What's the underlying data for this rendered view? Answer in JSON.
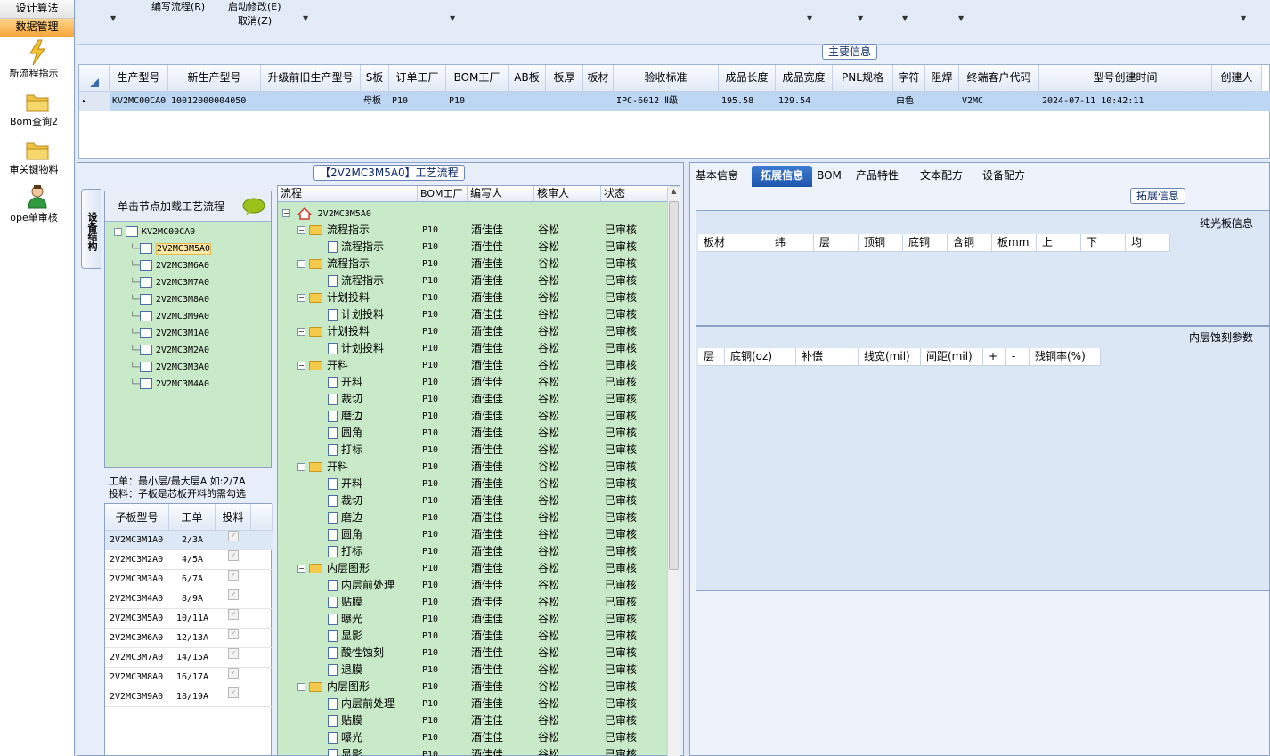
{
  "left_nav": {
    "tabs": [
      {
        "label": "设计算法"
      },
      {
        "label": "数据管理"
      }
    ],
    "items": [
      {
        "label": "新流程指示",
        "icon": "lightning-icon"
      },
      {
        "label": "Bom查询2",
        "icon": "folder-icon"
      },
      {
        "label": "审关键物料",
        "icon": "folder-icon"
      },
      {
        "label": "ope单审核",
        "icon": "user-icon"
      }
    ]
  },
  "toolbar": {
    "edit_flow": "编写流程(R)",
    "start_modify": "启动修改(E)",
    "cancel": "取消(Z)"
  },
  "main_info": {
    "legend": "主要信息",
    "columns": [
      "生产型号",
      "新生产型号",
      "升级前旧生产型号",
      "S板",
      "订单工厂",
      "BOM工厂",
      "AB板",
      "板厚",
      "板材",
      "验收标准",
      "成品长度",
      "成品宽度",
      "PNL规格",
      "字符",
      "阻焊",
      "终端客户代码",
      "型号创建时间",
      "创建人"
    ],
    "row": [
      "KV2MC00CA0",
      "10012000004050",
      "",
      "母板",
      "P10",
      "P10",
      "",
      "",
      "",
      "IPC-6012 Ⅱ级",
      "195.58",
      "129.54",
      "",
      "白色",
      "",
      "V2MC",
      "2024-07-11 10:42:11",
      ""
    ]
  },
  "flow_panel": {
    "legend": "【2V2MC3M5A0】工艺流程",
    "vertical_tab": "设备结构",
    "tree_header": "单击节点加载工艺流程",
    "tree_root": "KV2MC00CA0",
    "tree_nodes": [
      "2V2MC3M5A0",
      "2V2MC3M6A0",
      "2V2MC3M7A0",
      "2V2MC3M8A0",
      "2V2MC3M9A0",
      "2V2MC3M1A0",
      "2V2MC3M2A0",
      "2V2MC3M3A0",
      "2V2MC3M4A0"
    ],
    "note1": "工单：最小层/最大层A 如:2/7A",
    "note2": "投料：子板是芯板开料的需勾选",
    "sub_columns": [
      "子板型号",
      "工单",
      "投料"
    ],
    "sub_rows": [
      {
        "model": "2V2MC3M1A0",
        "order": "2/3A"
      },
      {
        "model": "2V2MC3M2A0",
        "order": "4/5A"
      },
      {
        "model": "2V2MC3M3A0",
        "order": "6/7A"
      },
      {
        "model": "2V2MC3M4A0",
        "order": "8/9A"
      },
      {
        "model": "2V2MC3M5A0",
        "order": "10/11A"
      },
      {
        "model": "2V2MC3M6A0",
        "order": "12/13A"
      },
      {
        "model": "2V2MC3M7A0",
        "order": "14/15A"
      },
      {
        "model": "2V2MC3M8A0",
        "order": "16/17A"
      },
      {
        "model": "2V2MC3M9A0",
        "order": "18/19A"
      }
    ],
    "flow_columns": [
      "流程",
      "BOM工厂",
      "编写人",
      "核审人",
      "状态"
    ],
    "flow_root": "2V2MC3M5A0",
    "flow_rows": [
      {
        "name": "流程指示",
        "folder": true,
        "bom": "P10",
        "writer": "酒佳佳",
        "reviewer": "谷松",
        "status": "已审核"
      },
      {
        "name": "流程指示",
        "folder": false,
        "bom": "P10",
        "writer": "酒佳佳",
        "reviewer": "谷松",
        "status": "已审核"
      },
      {
        "name": "流程指示",
        "folder": true,
        "bom": "P10",
        "writer": "酒佳佳",
        "reviewer": "谷松",
        "status": "已审核"
      },
      {
        "name": "流程指示",
        "folder": false,
        "bom": "P10",
        "writer": "酒佳佳",
        "reviewer": "谷松",
        "status": "已审核"
      },
      {
        "name": "计划投料",
        "folder": true,
        "bom": "P10",
        "writer": "酒佳佳",
        "reviewer": "谷松",
        "status": "已审核"
      },
      {
        "name": "计划投料",
        "folder": false,
        "bom": "P10",
        "writer": "酒佳佳",
        "reviewer": "谷松",
        "status": "已审核"
      },
      {
        "name": "计划投料",
        "folder": true,
        "bom": "P10",
        "writer": "酒佳佳",
        "reviewer": "谷松",
        "status": "已审核"
      },
      {
        "name": "计划投料",
        "folder": false,
        "bom": "P10",
        "writer": "酒佳佳",
        "reviewer": "谷松",
        "status": "已审核"
      },
      {
        "name": "开料",
        "folder": true,
        "bom": "P10",
        "writer": "酒佳佳",
        "reviewer": "谷松",
        "status": "已审核"
      },
      {
        "name": "开料",
        "folder": false,
        "bom": "P10",
        "writer": "酒佳佳",
        "reviewer": "谷松",
        "status": "已审核"
      },
      {
        "name": "裁切",
        "folder": false,
        "bom": "P10",
        "writer": "酒佳佳",
        "reviewer": "谷松",
        "status": "已审核"
      },
      {
        "name": "磨边",
        "folder": false,
        "bom": "P10",
        "writer": "酒佳佳",
        "reviewer": "谷松",
        "status": "已审核"
      },
      {
        "name": "圆角",
        "folder": false,
        "bom": "P10",
        "writer": "酒佳佳",
        "reviewer": "谷松",
        "status": "已审核"
      },
      {
        "name": "打标",
        "folder": false,
        "bom": "P10",
        "writer": "酒佳佳",
        "reviewer": "谷松",
        "status": "已审核"
      },
      {
        "name": "开料",
        "folder": true,
        "bom": "P10",
        "writer": "酒佳佳",
        "reviewer": "谷松",
        "status": "已审核"
      },
      {
        "name": "开料",
        "folder": false,
        "bom": "P10",
        "writer": "酒佳佳",
        "reviewer": "谷松",
        "status": "已审核"
      },
      {
        "name": "裁切",
        "folder": false,
        "bom": "P10",
        "writer": "酒佳佳",
        "reviewer": "谷松",
        "status": "已审核"
      },
      {
        "name": "磨边",
        "folder": false,
        "bom": "P10",
        "writer": "酒佳佳",
        "reviewer": "谷松",
        "status": "已审核"
      },
      {
        "name": "圆角",
        "folder": false,
        "bom": "P10",
        "writer": "酒佳佳",
        "reviewer": "谷松",
        "status": "已审核"
      },
      {
        "name": "打标",
        "folder": false,
        "bom": "P10",
        "writer": "酒佳佳",
        "reviewer": "谷松",
        "status": "已审核"
      },
      {
        "name": "内层图形",
        "folder": true,
        "bom": "P10",
        "writer": "酒佳佳",
        "reviewer": "谷松",
        "status": "已审核"
      },
      {
        "name": "内层前处理",
        "folder": false,
        "bom": "P10",
        "writer": "酒佳佳",
        "reviewer": "谷松",
        "status": "已审核"
      },
      {
        "name": "贴膜",
        "folder": false,
        "bom": "P10",
        "writer": "酒佳佳",
        "reviewer": "谷松",
        "status": "已审核"
      },
      {
        "name": "曝光",
        "folder": false,
        "bom": "P10",
        "writer": "酒佳佳",
        "reviewer": "谷松",
        "status": "已审核"
      },
      {
        "name": "显影",
        "folder": false,
        "bom": "P10",
        "writer": "酒佳佳",
        "reviewer": "谷松",
        "status": "已审核"
      },
      {
        "name": "酸性蚀刻",
        "folder": false,
        "bom": "P10",
        "writer": "酒佳佳",
        "reviewer": "谷松",
        "status": "已审核"
      },
      {
        "name": "退膜",
        "folder": false,
        "bom": "P10",
        "writer": "酒佳佳",
        "reviewer": "谷松",
        "status": "已审核"
      },
      {
        "name": "内层图形",
        "folder": true,
        "bom": "P10",
        "writer": "酒佳佳",
        "reviewer": "谷松",
        "status": "已审核"
      },
      {
        "name": "内层前处理",
        "folder": false,
        "bom": "P10",
        "writer": "酒佳佳",
        "reviewer": "谷松",
        "status": "已审核"
      },
      {
        "name": "贴膜",
        "folder": false,
        "bom": "P10",
        "writer": "酒佳佳",
        "reviewer": "谷松",
        "status": "已审核"
      },
      {
        "name": "曝光",
        "folder": false,
        "bom": "P10",
        "writer": "酒佳佳",
        "reviewer": "谷松",
        "status": "已审核"
      },
      {
        "name": "显影",
        "folder": false,
        "bom": "P10",
        "writer": "酒佳佳",
        "reviewer": "谷松",
        "status": "已审核"
      }
    ]
  },
  "right_panel": {
    "tabs": [
      "基本信息",
      "拓展信息",
      "BOM",
      "产品特性",
      "文本配方",
      "设备配方"
    ],
    "active_tab": "拓展信息",
    "legend": "拓展信息",
    "section1_title": "纯光板信息",
    "section1_columns": [
      "板材",
      "纬",
      "层",
      "顶铜",
      "底铜",
      "含铜",
      "板mm",
      "上",
      "下",
      "均"
    ],
    "section2_title": "内层蚀刻参数",
    "section2_columns": [
      "层",
      "底铜(oz)",
      "补偿",
      "线宽(mil)",
      "间距(mil)",
      "+",
      "-",
      "残铜率(%)"
    ]
  }
}
